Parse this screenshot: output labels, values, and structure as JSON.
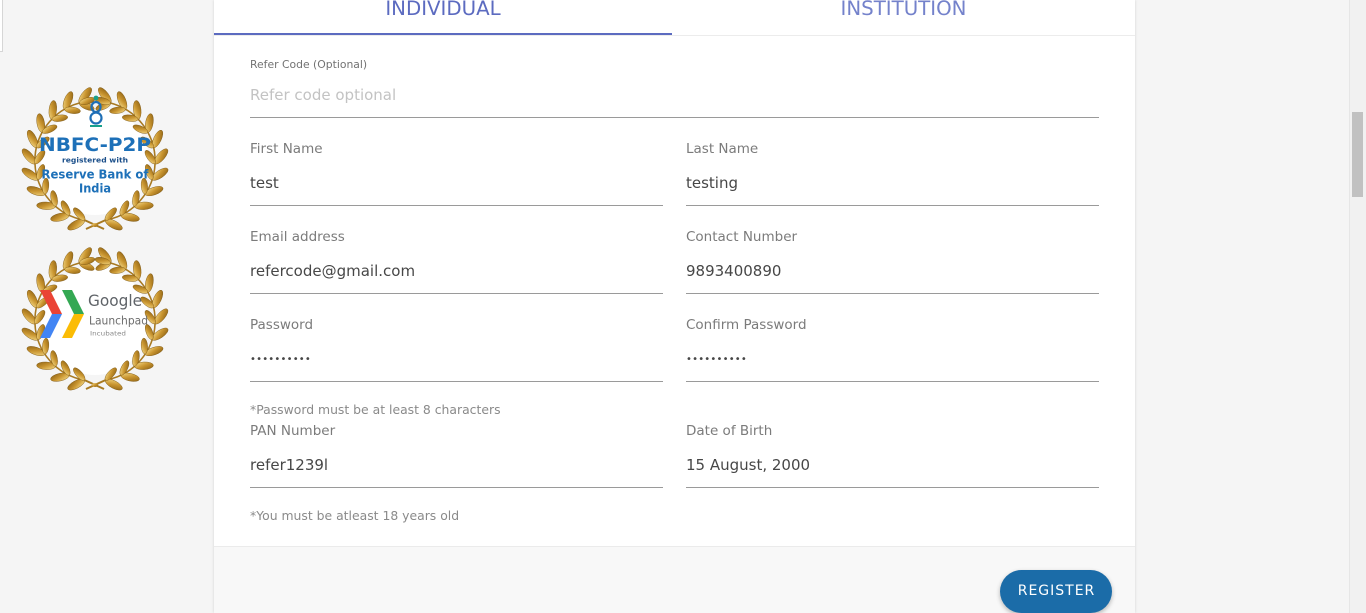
{
  "tabs": [
    {
      "label": "INDIVIDUAL",
      "active": true
    },
    {
      "label": "INSTITUTION",
      "active": false
    }
  ],
  "badges": {
    "nbfc": {
      "title": "NBFC-P2P",
      "subtitle": "registered with",
      "line1": "Reserve Bank of",
      "line2": "India"
    },
    "google": {
      "brand": "Google",
      "product": "Launchpad",
      "status": "Incubated"
    }
  },
  "form": {
    "refer_code": {
      "label": "Refer Code (Optional)",
      "placeholder": "Refer code optional"
    },
    "first_name": {
      "label": "First Name",
      "value": "test"
    },
    "last_name": {
      "label": "Last Name",
      "value": "testing"
    },
    "email": {
      "label": "Email address",
      "value": "refercode@gmail.com"
    },
    "contact": {
      "label": "Contact Number",
      "value": "9893400890"
    },
    "password": {
      "label": "Password",
      "value": "••••••••••"
    },
    "confirm_password": {
      "label": "Confirm Password",
      "value": "••••••••••"
    },
    "password_hint": "*Password must be at least 8 characters",
    "pan": {
      "label": "PAN Number",
      "value": "refer1239l"
    },
    "dob": {
      "label": "Date of Birth",
      "value": "15 August, 2000"
    },
    "age_hint": "*You must be atleast 18 years old"
  },
  "register_button": {
    "label": "REGISTER"
  },
  "colors": {
    "accent": "#5c6bc0",
    "register_button": "#1b6ca8"
  },
  "icons": {
    "nbfc_badge": "laurel-seal-icon",
    "google_badge": "laurel-seal-icon",
    "launchpad_logo": "chevrons-icon"
  }
}
